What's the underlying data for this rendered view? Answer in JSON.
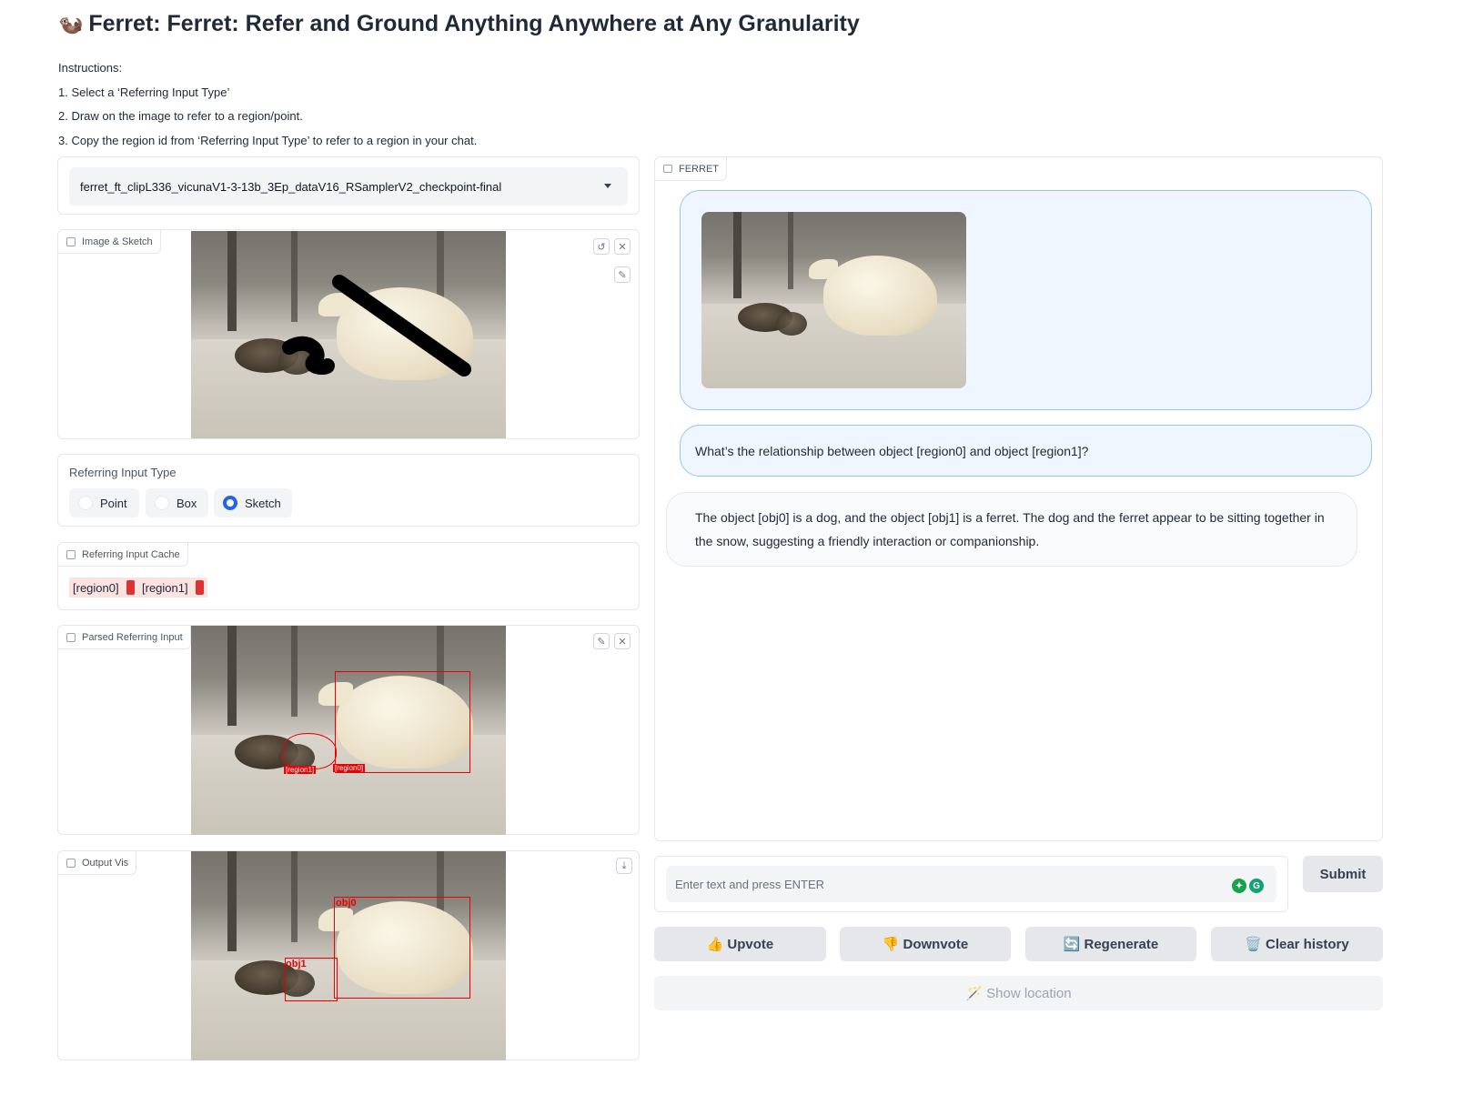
{
  "header": {
    "emoji": "🦦",
    "title": "Ferret: Ferret: Refer and Ground Anything Anywhere at Any Granularity"
  },
  "instructions": [
    "Instructions:",
    "1. Select a ‘Referring Input Type’",
    "2. Draw on the image to refer to a region/point.",
    "3. Copy the region id from ‘Referring Input Type’ to refer to a region in your chat."
  ],
  "model_select": {
    "value": "ferret_ft_clipL336_vicunaV1-3-13b_3Ep_dataV16_RSamplerV2_checkpoint-final"
  },
  "image_sketch": {
    "label": "Image & Sketch"
  },
  "referring_type": {
    "label": "Referring Input Type",
    "options": [
      "Point",
      "Box",
      "Sketch"
    ],
    "selected": "Sketch"
  },
  "cache": {
    "label": "Referring Input Cache",
    "items": [
      "[region0]",
      "[region1]"
    ],
    "swatch_color": "#e03131"
  },
  "parsed": {
    "label": "Parsed Referring Input",
    "tags": [
      "[region1]",
      "[region0]"
    ]
  },
  "output_vis": {
    "label": "Output Vis",
    "tags": [
      "obj0",
      "obj1"
    ]
  },
  "chat": {
    "label": "FERRET",
    "user_message": "What’s the relationship between object [region0] and object [region1]?",
    "bot_message": "The object [obj0] is a dog, and the object [obj1] is a ferret. The dog and the ferret appear to be sitting together in the snow, suggesting a friendly interaction or companionship."
  },
  "input": {
    "placeholder": "Enter text and press ENTER"
  },
  "buttons": {
    "submit": "Submit",
    "upvote": "Upvote",
    "upvote_icon": "👍",
    "downvote": "Downvote",
    "downvote_icon": "👎",
    "regenerate": "Regenerate",
    "regenerate_icon": "🔄",
    "clear": "Clear history",
    "clear_icon": "🗑️",
    "show_location": "Show location",
    "show_location_icon": "🪄"
  },
  "colors": {
    "accent": "#2563eb",
    "region": "#ee0000",
    "user_bubble": "#eff6ff"
  }
}
